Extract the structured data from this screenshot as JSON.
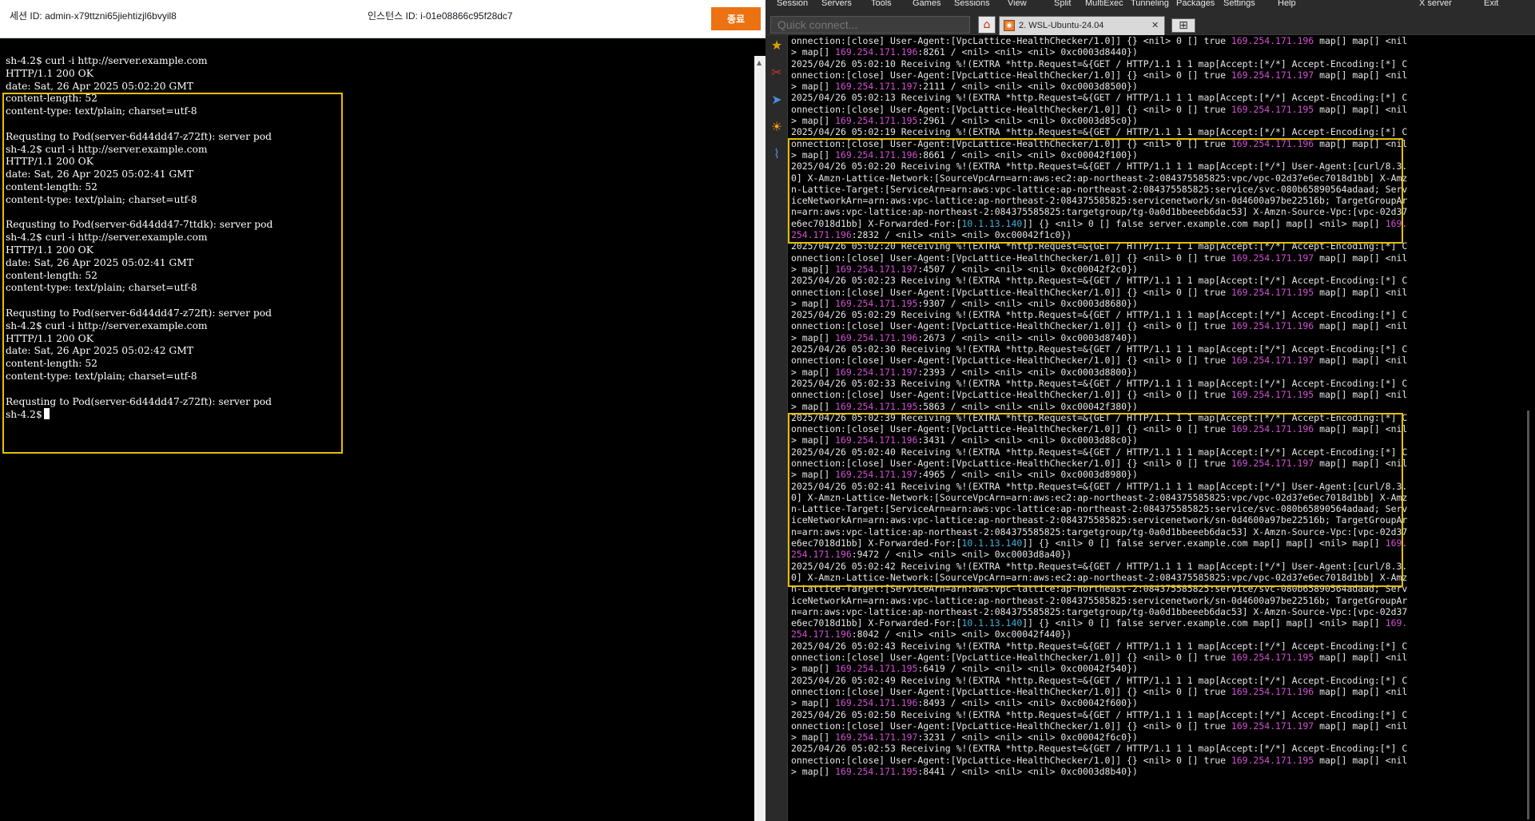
{
  "aws_session": {
    "session_id": "세션 ID: admin-x79ttzni65jiehtizjl6bvyil8",
    "instance_id": "인스턴스 ID: i-01e08866c95f28dc7",
    "terminate_label": "종료",
    "lines": [
      "sh-4.2$ curl -i http://server.example.com",
      "HTTP/1.1 200 OK",
      "date: Sat, 26 Apr 2025 05:02:20 GMT",
      "content-length: 52",
      "content-type: text/plain; charset=utf-8",
      "",
      "Requsting to Pod(server-6d44dd47-z72ft): server pod",
      "sh-4.2$ curl -i http://server.example.com",
      "HTTP/1.1 200 OK",
      "date: Sat, 26 Apr 2025 05:02:41 GMT",
      "content-length: 52",
      "content-type: text/plain; charset=utf-8",
      "",
      "Requsting to Pod(server-6d44dd47-7ttdk): server pod",
      "sh-4.2$ curl -i http://server.example.com",
      "HTTP/1.1 200 OK",
      "date: Sat, 26 Apr 2025 05:02:41 GMT",
      "content-length: 52",
      "content-type: text/plain; charset=utf-8",
      "",
      "Requsting to Pod(server-6d44dd47-z72ft): server pod",
      "sh-4.2$ curl -i http://server.example.com",
      "HTTP/1.1 200 OK",
      "date: Sat, 26 Apr 2025 05:02:42 GMT",
      "content-length: 52",
      "content-type: text/plain; charset=utf-8",
      "",
      "Requsting to Pod(server-6d44dd47-z72ft): server pod"
    ],
    "prompt": "sh-4.2$"
  },
  "moba": {
    "menu": [
      "Session",
      "Servers",
      "Tools",
      "Games",
      "Sessions",
      "View",
      "Split",
      "MultiExec",
      "Tunneling",
      "Packages",
      "Settings",
      "Help",
      "X server",
      "Exit"
    ],
    "quick_connect_placeholder": "Quick connect...",
    "tab_label": "2. WSL-Ubuntu-24.04",
    "tab_close": "✕",
    "lines": [
      [
        [
          "onnection:[close] User-Agent:[VpcLattice-HealthChecker/1.0]] {} <nil> 0 [] true ",
          ""
        ],
        [
          "169.254.171.196",
          "ip"
        ],
        [
          " map[] map[] <nil",
          ""
        ]
      ],
      [
        [
          "> map[] ",
          ""
        ],
        [
          "169.254.171.196",
          "ip"
        ],
        [
          ":8261 / <nil> <nil> <nil> 0xc0003d8440})",
          ""
        ]
      ],
      [
        [
          "2025/04/26 05:02:10 Receiving %!(EXTRA *http.Request=&{GET / HTTP/1.1 1 1 map[Accept:[*/*] Accept-Encoding:[*] C",
          ""
        ]
      ],
      [
        [
          "onnection:[close] User-Agent:[VpcLattice-HealthChecker/1.0]] {} <nil> 0 [] true ",
          ""
        ],
        [
          "169.254.171.197",
          "ip"
        ],
        [
          " map[] map[] <nil",
          ""
        ]
      ],
      [
        [
          "> map[] ",
          ""
        ],
        [
          "169.254.171.197",
          "ip"
        ],
        [
          ":2111 / <nil> <nil> <nil> 0xc0003d8500})",
          ""
        ]
      ],
      [
        [
          "2025/04/26 05:02:13 Receiving %!(EXTRA *http.Request=&{GET / HTTP/1.1 1 1 map[Accept:[*/*] Accept-Encoding:[*] C",
          ""
        ]
      ],
      [
        [
          "onnection:[close] User-Agent:[VpcLattice-HealthChecker/1.0]] {} <nil> 0 [] true ",
          ""
        ],
        [
          "169.254.171.195",
          "ip"
        ],
        [
          " map[] map[] <nil",
          ""
        ]
      ],
      [
        [
          "> map[] ",
          ""
        ],
        [
          "169.254.171.195",
          "ip"
        ],
        [
          ":2961 / <nil> <nil> <nil> 0xc0003d85c0})",
          ""
        ]
      ],
      [
        [
          "2025/04/26 05:02:19 Receiving %!(EXTRA *http.Request=&{GET / HTTP/1.1 1 1 map[Accept:[*/*] Accept-Encoding:[*] C",
          ""
        ]
      ],
      [
        [
          "onnection:[close] User-Agent:[VpcLattice-HealthChecker/1.0]] {} <nil> 0 [] true ",
          ""
        ],
        [
          "169.254.171.196",
          "ip"
        ],
        [
          " map[] map[] <nil",
          ""
        ]
      ],
      [
        [
          "> map[] ",
          ""
        ],
        [
          "169.254.171.196",
          "ip"
        ],
        [
          ":8661 / <nil> <nil> <nil> 0xc00042f100})",
          ""
        ]
      ],
      [
        [
          "2025/04/26 05:02:20 Receiving %!(EXTRA *http.Request=&{GET / HTTP/1.1 1 1 map[Accept:[*/*] User-Agent:[curl/8.3.",
          ""
        ]
      ],
      [
        [
          "0] X-Amzn-Lattice-Network:[SourceVpcArn=arn:aws:ec2:ap-northeast-2:084375585825:vpc/vpc-02d37e6ec7018d1bb] X-Amz",
          ""
        ]
      ],
      [
        [
          "n-Lattice-Target:[ServiceArn=arn:aws:vpc-lattice:ap-northeast-2:084375585825:service/svc-080b65890564adaad; Serv",
          ""
        ]
      ],
      [
        [
          "iceNetworkArn=arn:aws:vpc-lattice:ap-northeast-2:084375585825:servicenetwork/sn-0d4600a97be22516b; TargetGroupAr",
          ""
        ]
      ],
      [
        [
          "n=arn:aws:vpc-lattice:ap-northeast-2:084375585825:targetgroup/tg-0a0d1bbeeeb6dac53] X-Amzn-Source-Vpc:[vpc-02d37",
          ""
        ]
      ],
      [
        [
          "e6ec7018d1bb] X-Forwarded-For:[",
          ""
        ],
        [
          "10.1.13.140",
          "cy"
        ],
        [
          "]] {} <nil> 0 [] false server.example.com map[] map[] <nil> map[] ",
          ""
        ],
        [
          "169.",
          "ip"
        ]
      ],
      [
        [
          "254.171.196",
          "ip"
        ],
        [
          ":2832 / <nil> <nil> <nil> 0xc00042f1c0})",
          ""
        ]
      ],
      [
        [
          "2025/04/26 05:02:20 Receiving %!(EXTRA *http.Request=&{GET / HTTP/1.1 1 1 map[Accept:[*/*] Accept-Encoding:[*] C",
          ""
        ]
      ],
      [
        [
          "onnection:[close] User-Agent:[VpcLattice-HealthChecker/1.0]] {} <nil> 0 [] true ",
          ""
        ],
        [
          "169.254.171.197",
          "ip"
        ],
        [
          " map[] map[] <nil",
          ""
        ]
      ],
      [
        [
          "> map[] ",
          ""
        ],
        [
          "169.254.171.197",
          "ip"
        ],
        [
          ":4507 / <nil> <nil> <nil> 0xc00042f2c0})",
          ""
        ]
      ],
      [
        [
          "2025/04/26 05:02:23 Receiving %!(EXTRA *http.Request=&{GET / HTTP/1.1 1 1 map[Accept:[*/*] Accept-Encoding:[*] C",
          ""
        ]
      ],
      [
        [
          "onnection:[close] User-Agent:[VpcLattice-HealthChecker/1.0]] {} <nil> 0 [] true ",
          ""
        ],
        [
          "169.254.171.195",
          "ip"
        ],
        [
          " map[] map[] <nil",
          ""
        ]
      ],
      [
        [
          "> map[] ",
          ""
        ],
        [
          "169.254.171.195",
          "ip"
        ],
        [
          ":9307 / <nil> <nil> <nil> 0xc0003d8680})",
          ""
        ]
      ],
      [
        [
          "2025/04/26 05:02:29 Receiving %!(EXTRA *http.Request=&{GET / HTTP/1.1 1 1 map[Accept:[*/*] Accept-Encoding:[*] C",
          ""
        ]
      ],
      [
        [
          "onnection:[close] User-Agent:[VpcLattice-HealthChecker/1.0]] {} <nil> 0 [] true ",
          ""
        ],
        [
          "169.254.171.196",
          "ip"
        ],
        [
          " map[] map[] <nil",
          ""
        ]
      ],
      [
        [
          "> map[] ",
          ""
        ],
        [
          "169.254.171.196",
          "ip"
        ],
        [
          ":2673 / <nil> <nil> <nil> 0xc0003d8740})",
          ""
        ]
      ],
      [
        [
          "2025/04/26 05:02:30 Receiving %!(EXTRA *http.Request=&{GET / HTTP/1.1 1 1 map[Accept:[*/*] Accept-Encoding:[*] C",
          ""
        ]
      ],
      [
        [
          "onnection:[close] User-Agent:[VpcLattice-HealthChecker/1.0]] {} <nil> 0 [] true ",
          ""
        ],
        [
          "169.254.171.197",
          "ip"
        ],
        [
          " map[] map[] <nil",
          ""
        ]
      ],
      [
        [
          "> map[] ",
          ""
        ],
        [
          "169.254.171.197",
          "ip"
        ],
        [
          ":2393 / <nil> <nil> <nil> 0xc0003d8800})",
          ""
        ]
      ],
      [
        [
          "2025/04/26 05:02:33 Receiving %!(EXTRA *http.Request=&{GET / HTTP/1.1 1 1 map[Accept:[*/*] Accept-Encoding:[*] C",
          ""
        ]
      ],
      [
        [
          "onnection:[close] User-Agent:[VpcLattice-HealthChecker/1.0]] {} <nil> 0 [] true ",
          ""
        ],
        [
          "169.254.171.195",
          "ip"
        ],
        [
          " map[] map[] <nil",
          ""
        ]
      ],
      [
        [
          "> map[] ",
          ""
        ],
        [
          "169.254.171.195",
          "ip"
        ],
        [
          ":5863 / <nil> <nil> <nil> 0xc00042f380})",
          ""
        ]
      ],
      [
        [
          "2025/04/26 05:02:39 Receiving %!(EXTRA *http.Request=&{GET / HTTP/1.1 1 1 map[Accept:[*/*] Accept-Encoding:[*] C",
          ""
        ]
      ],
      [
        [
          "onnection:[close] User-Agent:[VpcLattice-HealthChecker/1.0]] {} <nil> 0 [] true ",
          ""
        ],
        [
          "169.254.171.196",
          "ip"
        ],
        [
          " map[] map[] <nil",
          ""
        ]
      ],
      [
        [
          "> map[] ",
          ""
        ],
        [
          "169.254.171.196",
          "ip"
        ],
        [
          ":3431 / <nil> <nil> <nil> 0xc0003d88c0})",
          ""
        ]
      ],
      [
        [
          "2025/04/26 05:02:40 Receiving %!(EXTRA *http.Request=&{GET / HTTP/1.1 1 1 map[Accept:[*/*] Accept-Encoding:[*] C",
          ""
        ]
      ],
      [
        [
          "onnection:[close] User-Agent:[VpcLattice-HealthChecker/1.0]] {} <nil> 0 [] true ",
          ""
        ],
        [
          "169.254.171.197",
          "ip"
        ],
        [
          " map[] map[] <nil",
          ""
        ]
      ],
      [
        [
          "> map[] ",
          ""
        ],
        [
          "169.254.171.197",
          "ip"
        ],
        [
          ":4965 / <nil> <nil> <nil> 0xc0003d8980})",
          ""
        ]
      ],
      [
        [
          "2025/04/26 05:02:41 Receiving %!(EXTRA *http.Request=&{GET / HTTP/1.1 1 1 map[Accept:[*/*] User-Agent:[curl/8.3.",
          ""
        ]
      ],
      [
        [
          "0] X-Amzn-Lattice-Network:[SourceVpcArn=arn:aws:ec2:ap-northeast-2:084375585825:vpc/vpc-02d37e6ec7018d1bb] X-Amz",
          ""
        ]
      ],
      [
        [
          "n-Lattice-Target:[ServiceArn=arn:aws:vpc-lattice:ap-northeast-2:084375585825:service/svc-080b65890564adaad; Serv",
          ""
        ]
      ],
      [
        [
          "iceNetworkArn=arn:aws:vpc-lattice:ap-northeast-2:084375585825:servicenetwork/sn-0d4600a97be22516b; TargetGroupAr",
          ""
        ]
      ],
      [
        [
          "n=arn:aws:vpc-lattice:ap-northeast-2:084375585825:targetgroup/tg-0a0d1bbeeeb6dac53] X-Amzn-Source-Vpc:[vpc-02d37",
          ""
        ]
      ],
      [
        [
          "e6ec7018d1bb] X-Forwarded-For:[",
          ""
        ],
        [
          "10.1.13.140",
          "cy"
        ],
        [
          "]] {} <nil> 0 [] false server.example.com map[] map[] <nil> map[] ",
          ""
        ],
        [
          "169.",
          "ip"
        ]
      ],
      [
        [
          "254.171.196",
          "ip"
        ],
        [
          ":9472 / <nil> <nil> <nil> 0xc0003d8a40})",
          ""
        ]
      ],
      [
        [
          "2025/04/26 05:02:42 Receiving %!(EXTRA *http.Request=&{GET / HTTP/1.1 1 1 map[Accept:[*/*] User-Agent:[curl/8.3.",
          ""
        ]
      ],
      [
        [
          "0] X-Amzn-Lattice-Network:[SourceVpcArn=arn:aws:ec2:ap-northeast-2:084375585825:vpc/vpc-02d37e6ec7018d1bb] X-Amz",
          ""
        ]
      ],
      [
        [
          "n-Lattice-Target:[ServiceArn=arn:aws:vpc-lattice:ap-northeast-2:084375585825:service/svc-080b65890564adaad; Serv",
          ""
        ]
      ],
      [
        [
          "iceNetworkArn=arn:aws:vpc-lattice:ap-northeast-2:084375585825:servicenetwork/sn-0d4600a97be22516b; TargetGroupAr",
          ""
        ]
      ],
      [
        [
          "n=arn:aws:vpc-lattice:ap-northeast-2:084375585825:targetgroup/tg-0a0d1bbeeeb6dac53] X-Amzn-Source-Vpc:[vpc-02d37",
          ""
        ]
      ],
      [
        [
          "e6ec7018d1bb] X-Forwarded-For:[",
          ""
        ],
        [
          "10.1.13.140",
          "cy"
        ],
        [
          "]] {} <nil> 0 [] false server.example.com map[] map[] <nil> map[] ",
          ""
        ],
        [
          "169.",
          "ip"
        ]
      ],
      [
        [
          "254.171.196",
          "ip"
        ],
        [
          ":8042 / <nil> <nil> <nil> 0xc00042f440})",
          ""
        ]
      ],
      [
        [
          "2025/04/26 05:02:43 Receiving %!(EXTRA *http.Request=&{GET / HTTP/1.1 1 1 map[Accept:[*/*] Accept-Encoding:[*] C",
          ""
        ]
      ],
      [
        [
          "onnection:[close] User-Agent:[VpcLattice-HealthChecker/1.0]] {} <nil> 0 [] true ",
          ""
        ],
        [
          "169.254.171.195",
          "ip"
        ],
        [
          " map[] map[] <nil",
          ""
        ]
      ],
      [
        [
          "> map[] ",
          ""
        ],
        [
          "169.254.171.195",
          "ip"
        ],
        [
          ":6419 / <nil> <nil> <nil> 0xc00042f540})",
          ""
        ]
      ],
      [
        [
          "2025/04/26 05:02:49 Receiving %!(EXTRA *http.Request=&{GET / HTTP/1.1 1 1 map[Accept:[*/*] Accept-Encoding:[*] C",
          ""
        ]
      ],
      [
        [
          "onnection:[close] User-Agent:[VpcLattice-HealthChecker/1.0]] {} <nil> 0 [] true ",
          ""
        ],
        [
          "169.254.171.196",
          "ip"
        ],
        [
          " map[] map[] <nil",
          ""
        ]
      ],
      [
        [
          "> map[] ",
          ""
        ],
        [
          "169.254.171.196",
          "ip"
        ],
        [
          ":8493 / <nil> <nil> <nil> 0xc00042f600})",
          ""
        ]
      ],
      [
        [
          "2025/04/26 05:02:50 Receiving %!(EXTRA *http.Request=&{GET / HTTP/1.1 1 1 map[Accept:[*/*] Accept-Encoding:[*] C",
          ""
        ]
      ],
      [
        [
          "onnection:[close] User-Agent:[VpcLattice-HealthChecker/1.0]] {} <nil> 0 [] true ",
          ""
        ],
        [
          "169.254.171.197",
          "ip"
        ],
        [
          " map[] map[] <nil",
          ""
        ]
      ],
      [
        [
          "> map[] ",
          ""
        ],
        [
          "169.254.171.197",
          "ip"
        ],
        [
          ":3231 / <nil> <nil> <nil> 0xc00042f6c0})",
          ""
        ]
      ],
      [
        [
          "2025/04/26 05:02:53 Receiving %!(EXTRA *http.Request=&{GET / HTTP/1.1 1 1 map[Accept:[*/*] Accept-Encoding:[*] C",
          ""
        ]
      ],
      [
        [
          "onnection:[close] User-Agent:[VpcLattice-HealthChecker/1.0]] {} <nil> 0 [] true ",
          ""
        ],
        [
          "169.254.171.195",
          "ip"
        ],
        [
          " map[] map[] <nil",
          ""
        ]
      ],
      [
        [
          "> map[] ",
          ""
        ],
        [
          "169.254.171.195",
          "ip"
        ],
        [
          ":8441 / <nil> <nil> <nil> 0xc0003d8b40})",
          ""
        ]
      ]
    ]
  },
  "colors": {
    "highlight_border": "#e5c100",
    "ip_magenta": "#d34fd3",
    "forwarded_cyan": "#3fb0d8",
    "terminate_orange": "#ec7211"
  },
  "icons": [
    "home-icon",
    "ubuntu-tab-icon",
    "star-icon",
    "tools-icon",
    "send-icon",
    "sun-icon",
    "attach-icon"
  ]
}
